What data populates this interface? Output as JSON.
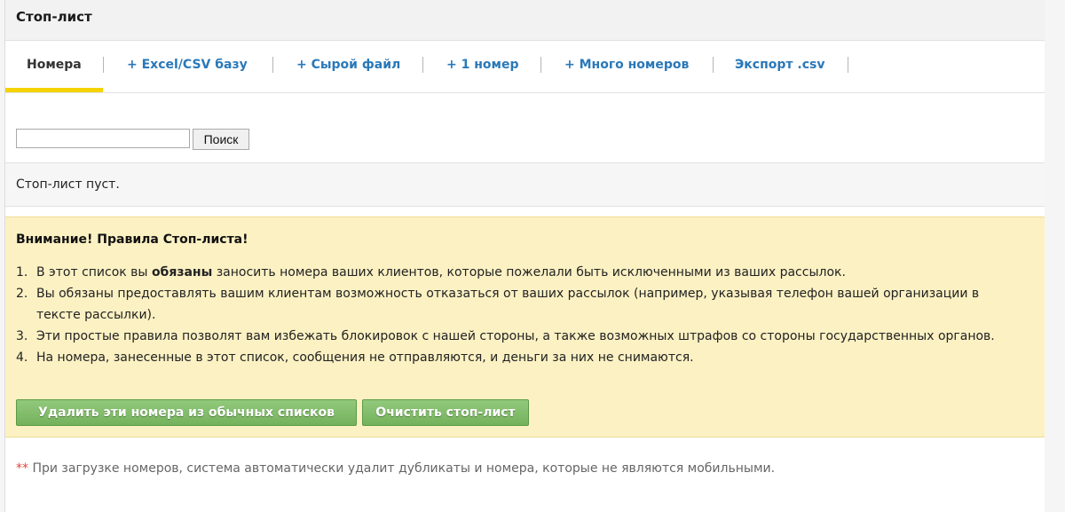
{
  "header": {
    "title": "Стоп-лист"
  },
  "tabs": [
    {
      "label": "Номера",
      "active": true
    },
    {
      "label": "+ Excel/CSV базу",
      "active": false
    },
    {
      "label": "+ Сырой файл",
      "active": false
    },
    {
      "label": "+ 1 номер",
      "active": false
    },
    {
      "label": "+ Много номеров",
      "active": false
    },
    {
      "label": "Экспорт .csv",
      "active": false
    }
  ],
  "search": {
    "value": "",
    "button_label": "Поиск"
  },
  "list": {
    "empty_text": "Стоп-лист пуст."
  },
  "warning": {
    "title": "Внимание! Правила Стоп-листа!",
    "rules": [
      {
        "num": "1.",
        "pre": "В этот список вы ",
        "bold": "обязаны",
        "post": " заносить номера ваших клиентов, которые пожелали быть исключенными из ваших рассылок."
      },
      {
        "num": "2.",
        "text": "Вы обязаны предоставлять вашим клиентам возможность отказаться от ваших рассылок (например, указывая телефон вашей организации в тексте рассылки)."
      },
      {
        "num": "3.",
        "text": "Эти простые правила позволят вам избежать блокировок с нашей стороны, а также возможных штрафов со стороны государственных органов."
      },
      {
        "num": "4.",
        "text": "На номера, занесенные в этот список, сообщения не отправляются, и деньги за них не снимаются."
      }
    ],
    "buttons": {
      "remove_label": "Удалить эти номера из обычных списков",
      "clear_label": "Очистить стоп-лист"
    }
  },
  "footnote": {
    "marker": "**",
    "text": "При загрузке номеров, система автоматически удалит дубликаты и номера, которые не являются мобильными."
  },
  "colors": {
    "accent_tab_underline": "#f5d300",
    "link": "#2a78b8",
    "warning_bg": "#fcf1c3",
    "button_green": "#7cb964",
    "footnote_marker": "#e0433a"
  }
}
